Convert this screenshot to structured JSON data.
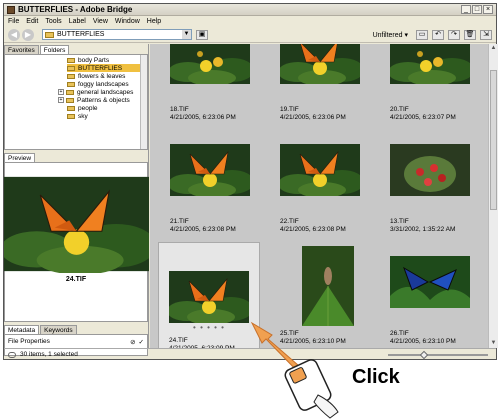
{
  "window": {
    "title": "BUTTERFLIES - Adobe Bridge",
    "controls": [
      "_",
      "□",
      "×"
    ]
  },
  "menu": [
    "File",
    "Edit",
    "Tools",
    "Label",
    "View",
    "Window",
    "Help"
  ],
  "toolbar": {
    "path": "BUTTERFLIES",
    "filter": "Unfiltered ▾"
  },
  "left": {
    "tabs": [
      "Favorites",
      "Folders"
    ],
    "folders": [
      {
        "label": "body Parts",
        "expand": ""
      },
      {
        "label": "BUTTERFLIES",
        "expand": "",
        "selected": true
      },
      {
        "label": "flowers & leaves",
        "expand": ""
      },
      {
        "label": "foggy landscapes",
        "expand": ""
      },
      {
        "label": "general landscapes",
        "expand": "+"
      },
      {
        "label": "Patterns & objects",
        "expand": "+"
      },
      {
        "label": "people",
        "expand": ""
      },
      {
        "label": "sky",
        "expand": ""
      }
    ],
    "preview_tab": "Preview",
    "preview_name": "24.TIF",
    "meta_tabs": [
      "Metadata",
      "Keywords"
    ],
    "meta_text": "File Properties"
  },
  "thumbnails": [
    {
      "name": "18.TIF",
      "date": "4/21/2005, 6:23:06 PM"
    },
    {
      "name": "19.TIF",
      "date": "4/21/2005, 6:23:06 PM"
    },
    {
      "name": "20.TIF",
      "date": "4/21/2005, 6:23:07 PM"
    },
    {
      "name": "21.TIF",
      "date": "4/21/2005, 6:23:08 PM"
    },
    {
      "name": "22.TIF",
      "date": "4/21/2005, 6:23:08 PM"
    },
    {
      "name": "13.TIF",
      "date": "3/31/2002, 1:35:22 AM"
    },
    {
      "name": "24.TIF",
      "date": "4/21/2005, 6:23:09 PM",
      "selected": true
    },
    {
      "name": "25.TIF",
      "date": "4/21/2005, 6:23:10 PM"
    },
    {
      "name": "26.TIF",
      "date": "4/21/2005, 6:23:10 PM"
    }
  ],
  "status": {
    "text": "30 items, 1 selected",
    "zoom_level": 0.35
  },
  "callout": {
    "label": "Click"
  }
}
